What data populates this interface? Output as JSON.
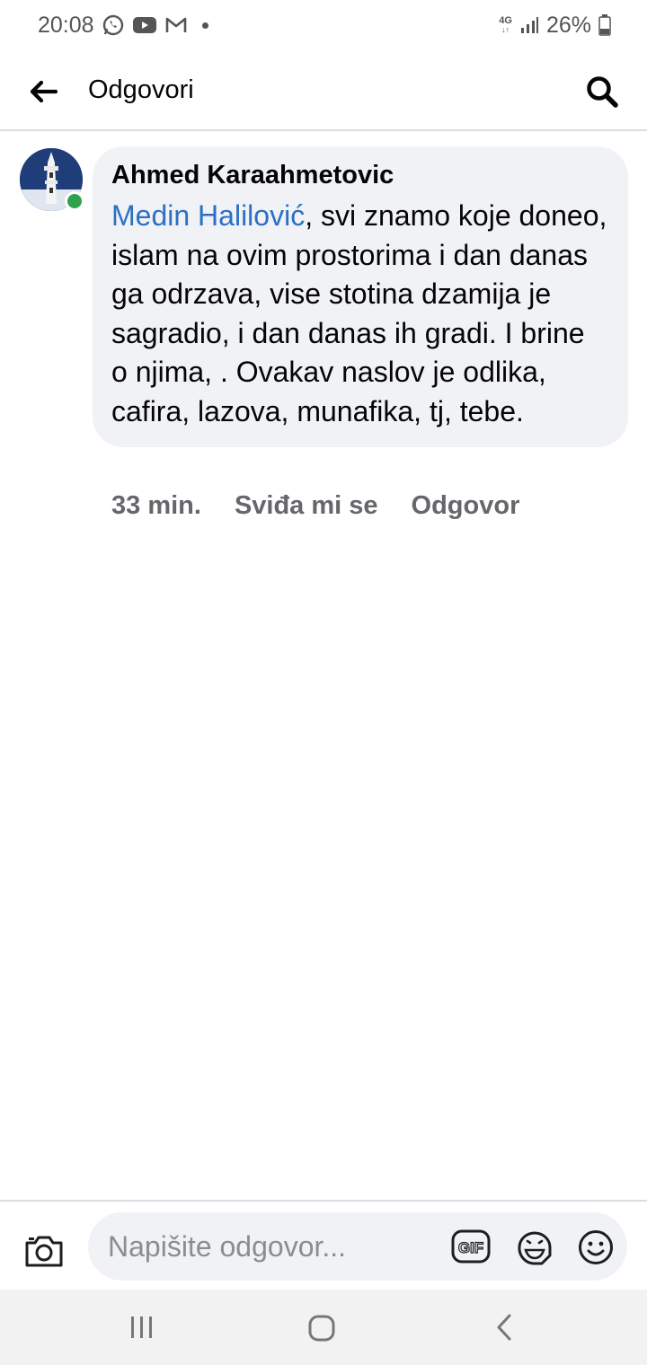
{
  "status_bar": {
    "time": "20:08",
    "network": "4G",
    "battery": "26%",
    "icons": [
      "whatsapp-icon",
      "youtube-icon",
      "gmail-icon",
      "signal-icon",
      "battery-icon"
    ]
  },
  "header": {
    "title": "Odgovori",
    "back_icon": "arrow-left-icon",
    "search_icon": "search-icon"
  },
  "comment": {
    "author": "Ahmed Karaahmetovic",
    "mention": "Medin Halilović",
    "text": ", svi znamo koje doneo, islam na ovim prostorima i dan danas ga odrzava, vise stotina dzamija je sagradio, i dan danas ih gradi. I brine o njima, . Ovakav naslov je odlika, cafira, lazova, munafika, tj, tebe.",
    "time": "33 min.",
    "like_label": "Sviđa mi se",
    "reply_label": "Odgovor",
    "online": true
  },
  "reply_bar": {
    "placeholder": "Napišite odgovor...",
    "value": "",
    "gif_label": "GIF"
  },
  "colors": {
    "mention": "#2d6fc4",
    "bubble": "#f0f2f5",
    "online": "#31a24c",
    "secondary_text": "#65676b"
  }
}
